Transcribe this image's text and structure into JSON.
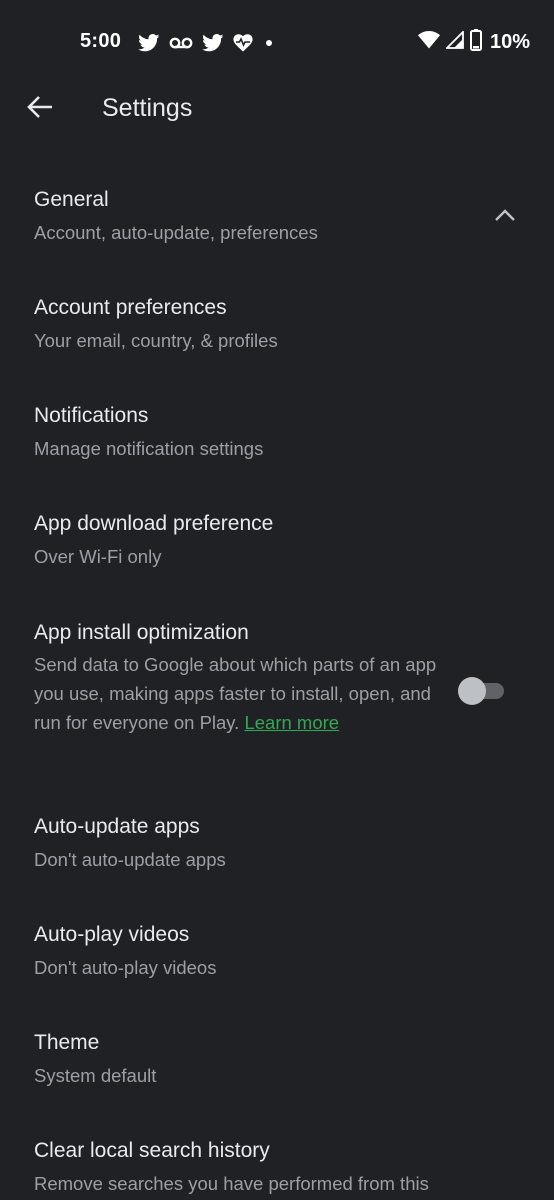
{
  "status_bar": {
    "time": "5:00",
    "battery_percent": "10%",
    "icons_left": [
      "twitter-icon",
      "voicemail-icon",
      "twitter-icon",
      "heart-pulse-icon",
      "dot-icon"
    ],
    "icons_right": [
      "wifi-icon",
      "cell-signal-icon",
      "battery-icon"
    ]
  },
  "app_bar": {
    "title": "Settings",
    "back_icon": "arrow-back-icon"
  },
  "section": {
    "title": "General",
    "subtitle": "Account, auto-update, preferences",
    "expanded": true
  },
  "items": [
    {
      "title": "Account preferences",
      "subtitle": "Your email, country, & profiles"
    },
    {
      "title": "Notifications",
      "subtitle": "Manage notification settings"
    },
    {
      "title": "App download preference",
      "subtitle": "Over Wi-Fi only"
    },
    {
      "title": "App install optimization",
      "subtitle": "Send data to Google about which parts of an app you use, making apps faster to install, open, and run for everyone on Play.",
      "link": "Learn more",
      "toggle": false
    },
    {
      "title": "Auto-update apps",
      "subtitle": "Don't auto-update apps"
    },
    {
      "title": "Auto-play videos",
      "subtitle": "Don't auto-play videos"
    },
    {
      "title": "Theme",
      "subtitle": "System default"
    },
    {
      "title": "Clear local search history",
      "subtitle": "Remove searches you have performed from this"
    }
  ],
  "colors": {
    "background": "#202124",
    "text_primary": "#e8eaed",
    "text_secondary": "#9aa0a6",
    "link": "#34a853"
  }
}
